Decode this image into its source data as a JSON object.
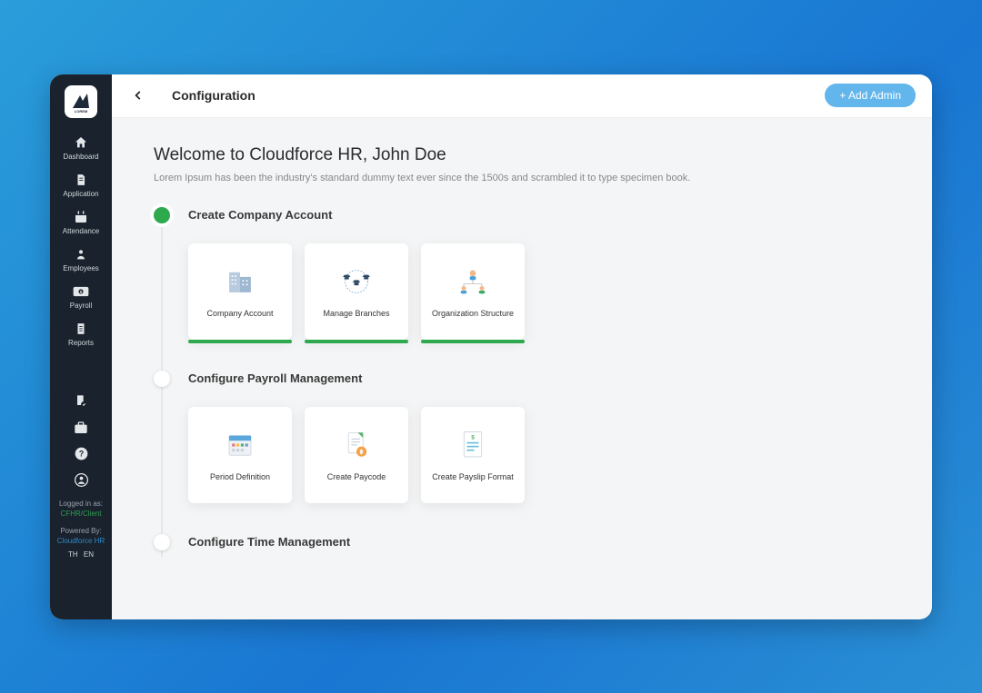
{
  "sidebar": {
    "logo_text": "LOREM",
    "items": [
      {
        "label": "Dashboard"
      },
      {
        "label": "Application"
      },
      {
        "label": "Attendance"
      },
      {
        "label": "Employees"
      },
      {
        "label": "Payroll"
      },
      {
        "label": "Reports"
      }
    ],
    "footer": {
      "logged_in_label": "Logged in as:",
      "tag": "CFHR/Client",
      "powered_label": "Powered By:",
      "brand": "Cloudforce HR",
      "lang_th": "TH",
      "lang_en": "EN"
    }
  },
  "header": {
    "title": "Configuration",
    "add_admin_label": "+ Add Admin"
  },
  "welcome": {
    "heading": "Welcome to Cloudforce HR, John Doe",
    "sub": "Lorem Ipsum has been the industry's standard dummy text ever since the 1500s and scrambled it to type specimen book."
  },
  "sections": [
    {
      "title": "Create Company Account",
      "done": true,
      "cards": [
        {
          "label": "Company Account"
        },
        {
          "label": "Manage Branches"
        },
        {
          "label": "Organization Structure"
        }
      ]
    },
    {
      "title": "Configure Payroll Management",
      "done": false,
      "cards": [
        {
          "label": "Period Definition"
        },
        {
          "label": "Create Paycode"
        },
        {
          "label": "Create Payslip Format"
        }
      ]
    },
    {
      "title": "Configure Time Management",
      "done": false,
      "cards": []
    }
  ]
}
